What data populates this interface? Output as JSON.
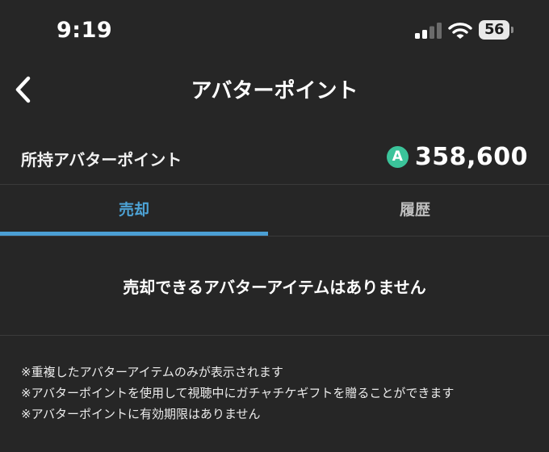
{
  "status_bar": {
    "time": "9:19",
    "battery_percent": "56",
    "signal_bars_active": 2,
    "signal_bars_total": 4
  },
  "nav": {
    "title": "アバターポイント",
    "back_icon": "chevron-left-icon"
  },
  "points": {
    "label": "所持アバターポイント",
    "icon_letter": "A",
    "icon_color": "#3bc39a",
    "value": "358,600"
  },
  "tabs": [
    {
      "label": "売却",
      "active": true
    },
    {
      "label": "履歴",
      "active": false
    }
  ],
  "accent_color": "#4b9fd4",
  "empty_message": "売却できるアバターアイテムはありません",
  "notes": [
    "※重複したアバターアイテムのみが表示されます",
    "※アバターポイントを使用して視聴中にガチャチケギフトを贈ることができます",
    "※アバターポイントに有効期限はありません"
  ]
}
